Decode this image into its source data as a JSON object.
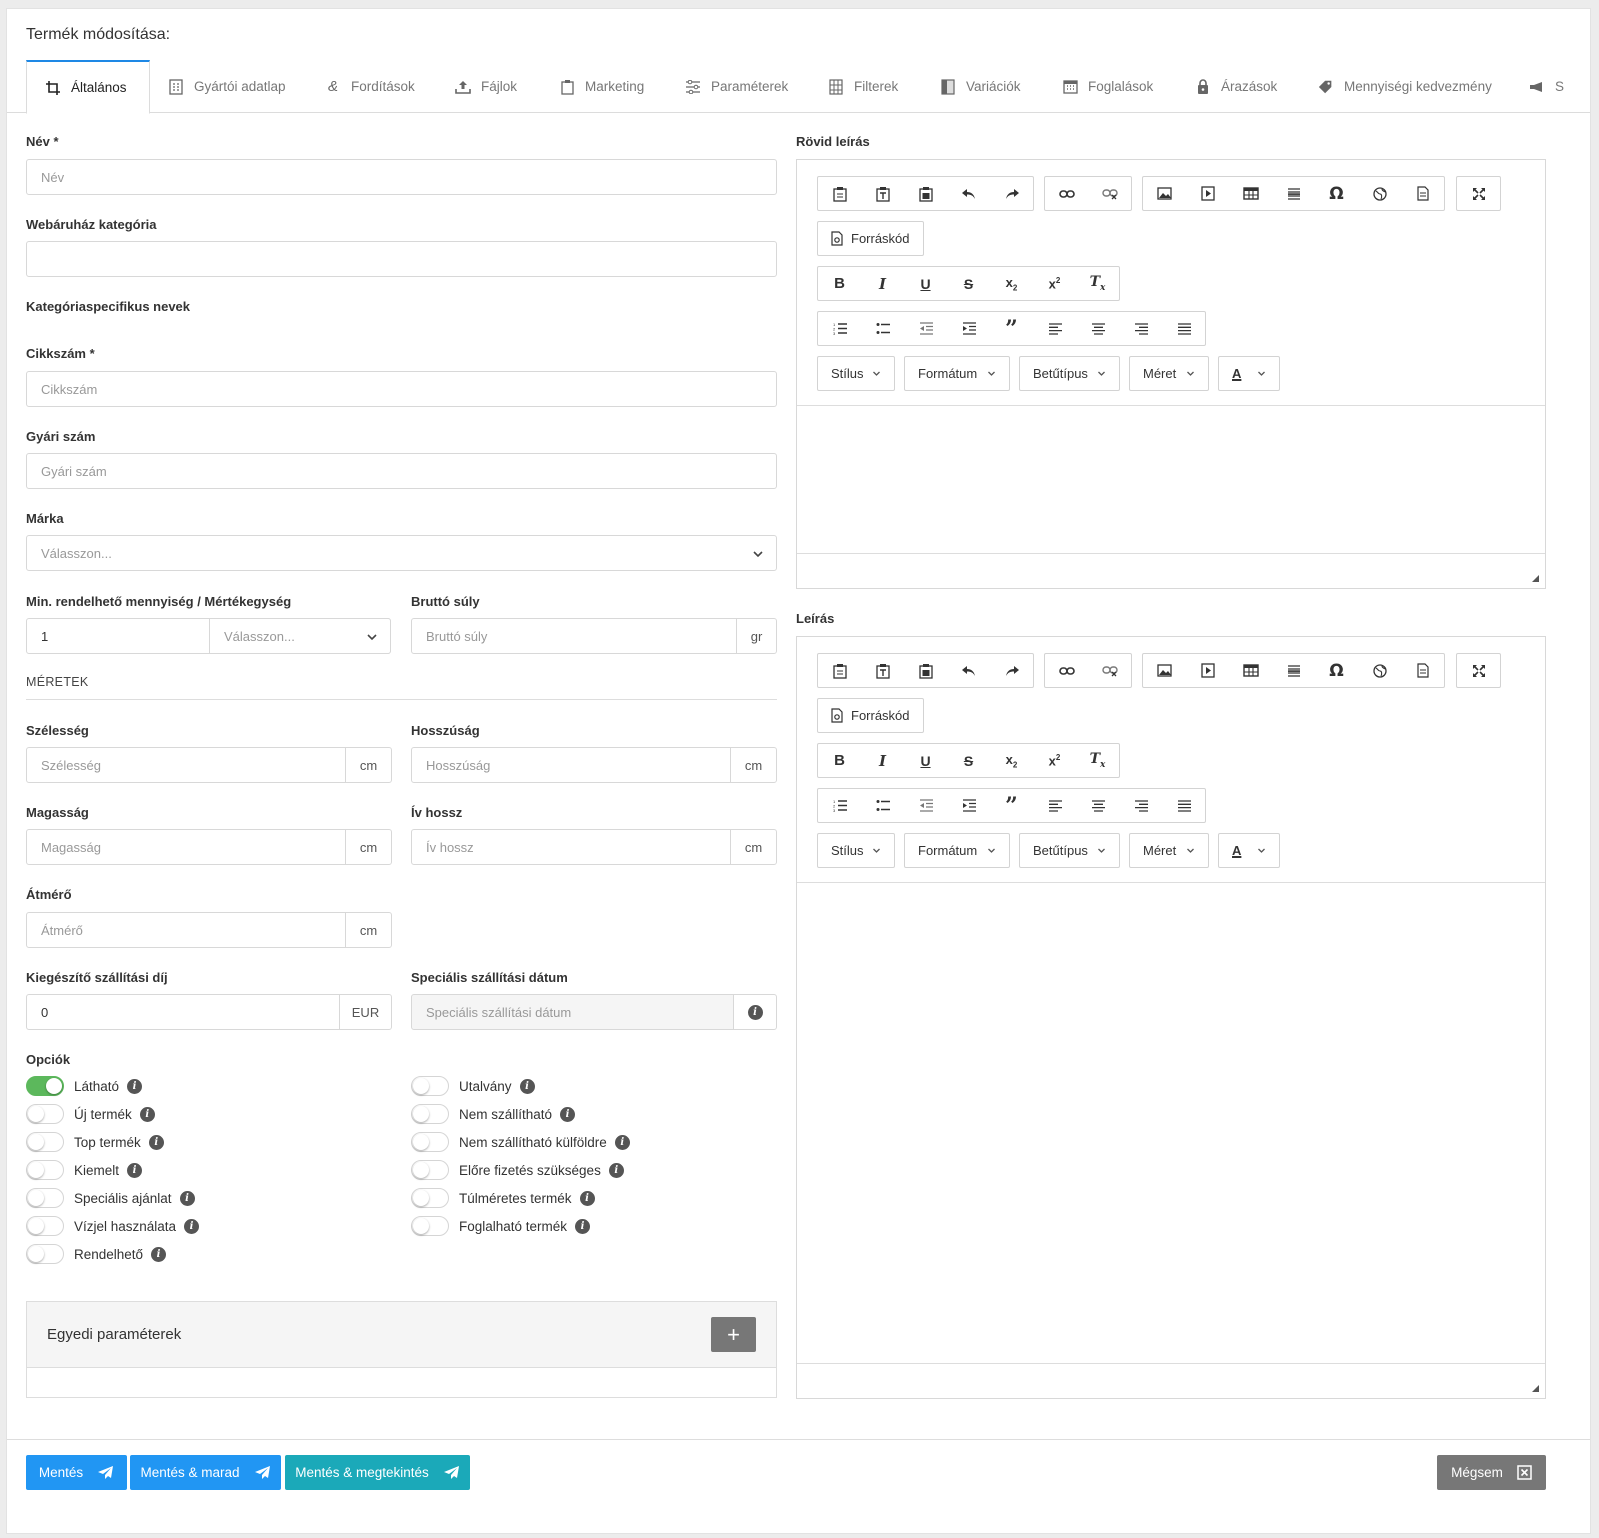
{
  "page_title": "Termék módosítása:",
  "tabs": [
    {
      "label": "Általános",
      "icon": "crop-icon",
      "active": true
    },
    {
      "label": "Gyártói adatlap",
      "icon": "document-icon"
    },
    {
      "label": "Fordítások",
      "icon": "ampersand-icon"
    },
    {
      "label": "Fájlok",
      "icon": "upload-icon"
    },
    {
      "label": "Marketing",
      "icon": "clipboard-icon"
    },
    {
      "label": "Paraméterek",
      "icon": "sliders-icon"
    },
    {
      "label": "Filterek",
      "icon": "grid-icon"
    },
    {
      "label": "Variációk",
      "icon": "gradient-icon"
    },
    {
      "label": "Foglalások",
      "icon": "calendar-icon"
    },
    {
      "label": "Árazások",
      "icon": "lock-icon"
    },
    {
      "label": "Mennyiségi kedvezmény",
      "icon": "tags-icon"
    },
    {
      "label": "S",
      "icon": "megaphone-icon"
    }
  ],
  "form": {
    "name_label": "Név *",
    "name_placeholder": "Név",
    "category_label": "Webáruház kategória",
    "category_value": "",
    "category_names_label": "Kategóriaspecifikus nevek",
    "sku_label": "Cikkszám *",
    "sku_placeholder": "Cikkszám",
    "factory_label": "Gyári szám",
    "factory_placeholder": "Gyári szám",
    "brand_label": "Márka",
    "brand_placeholder": "Válasszon...",
    "min_qty_label": "Min. rendelhető mennyiség / Mértékegység",
    "min_qty_value": "1",
    "unit_placeholder": "Válasszon...",
    "gross_weight_label": "Bruttó súly",
    "gross_weight_placeholder": "Bruttó súly",
    "gross_weight_unit": "gr",
    "dimensions_heading": "MÉRETEK",
    "width_label": "Szélesség",
    "width_placeholder": "Szélesség",
    "width_unit": "cm",
    "length_label": "Hosszúság",
    "length_placeholder": "Hosszúság",
    "length_unit": "cm",
    "height_label": "Magasság",
    "height_placeholder": "Magasság",
    "height_unit": "cm",
    "arc_label": "Ív hossz",
    "arc_placeholder": "Ív hossz",
    "arc_unit": "cm",
    "diameter_label": "Átmérő",
    "diameter_placeholder": "Átmérő",
    "diameter_unit": "cm",
    "extra_shipping_label": "Kiegészítő szállítási díj",
    "extra_shipping_value": "0",
    "extra_shipping_unit": "EUR",
    "special_date_label": "Speciális szállítási dátum",
    "special_date_placeholder": "Speciális szállítási dátum",
    "options_label": "Opciók"
  },
  "options_left": [
    {
      "label": "Látható",
      "on": true
    },
    {
      "label": "Új termék",
      "on": false
    },
    {
      "label": "Top termék",
      "on": false
    },
    {
      "label": "Kiemelt",
      "on": false
    },
    {
      "label": "Speciális ajánlat",
      "on": false
    },
    {
      "label": "Vízjel használata",
      "on": false
    },
    {
      "label": "Rendelhető",
      "on": false
    }
  ],
  "options_right": [
    {
      "label": "Utalvány",
      "on": false
    },
    {
      "label": "Nem szállítható",
      "on": false
    },
    {
      "label": "Nem szállítható külföldre",
      "on": false
    },
    {
      "label": "Előre fizetés szükséges",
      "on": false
    },
    {
      "label": "Túlméretes termék",
      "on": false
    },
    {
      "label": "Foglalható termék",
      "on": false
    }
  ],
  "custom_params": {
    "title": "Egyedi paraméterek",
    "add_label": "+"
  },
  "short_desc_label": "Rövid leírás",
  "desc_label": "Leírás",
  "editor": {
    "source_label": "Forráskód",
    "combos": [
      "Stílus",
      "Formátum",
      "Betűtípus",
      "Méret"
    ],
    "color_label": "A"
  },
  "footer": {
    "save": "Mentés",
    "save_stay": "Mentés & marad",
    "save_view": "Mentés & megtekintés",
    "cancel": "Mégsem"
  },
  "colors": {
    "primary": "#2196f3",
    "teal": "#1ba9b9",
    "toggle_on": "#5cb85c",
    "cancel": "#777777"
  }
}
